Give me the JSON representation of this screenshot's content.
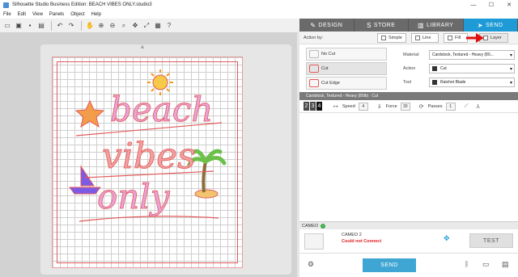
{
  "window": {
    "title": "Silhouette Studio Business Edition: BEACH VIBES ONLY.studio3",
    "minimize": "—",
    "maximize": "☐",
    "close": "✕"
  },
  "menu": [
    "File",
    "Edit",
    "View",
    "Panels",
    "Object",
    "Help"
  ],
  "toolbar": {
    "icons": [
      "new-icon",
      "open-icon",
      "save-icon",
      "print-icon",
      "undo-icon",
      "redo-icon",
      "pan-icon",
      "zoom-in-icon",
      "zoom-out-icon",
      "zoom-select-icon",
      "move-icon",
      "fit-icon",
      "grid-icon",
      "help-icon"
    ]
  },
  "nav_tabs": [
    {
      "label": "DESIGN",
      "active": false
    },
    {
      "label": "STORE",
      "active": false
    },
    {
      "label": "LIBRARY",
      "active": false
    },
    {
      "label": "SEND",
      "active": true
    }
  ],
  "send_panel": {
    "action_by_label": "Action by:",
    "action_modes": [
      "Simple",
      "Line",
      "Fill",
      "Layer"
    ],
    "active_mode": "Layer",
    "cut_modes": [
      "No Cut",
      "Cut",
      "Cut Edge"
    ],
    "active_cut_mode": "Cut",
    "material_label": "Material",
    "material_value": "Cardstock, Textured - Heavy (80...",
    "action_label": "Action",
    "action_value": "Cut",
    "tool_label": "Tool",
    "tool_value": "Ratchet Blade",
    "summary": "Cardstock, Textured - Heavy (80lb) : Cut",
    "blade_settings": [
      "2",
      "3",
      "4"
    ],
    "blade_active": "4",
    "speed_label": "Speed",
    "speed_value": "4",
    "force_label": "Force",
    "force_value": "30",
    "passes_label": "Passes",
    "passes_value": "1"
  },
  "device": {
    "header": "CAMEO",
    "name": "CAMEO 2",
    "status": "Could not Connect",
    "test_label": "TEST",
    "send_label": "SEND"
  },
  "artwork": {
    "line1": "beach",
    "line2": "vibes",
    "line3": "only"
  },
  "colors": {
    "accent": "#1e9bd7",
    "send_button": "#3fa6d4",
    "error": "#e02020",
    "cut_line": "#e35a5a",
    "lettering_pink": "#e9a3d8",
    "lettering_coral": "#f0a0a0"
  }
}
